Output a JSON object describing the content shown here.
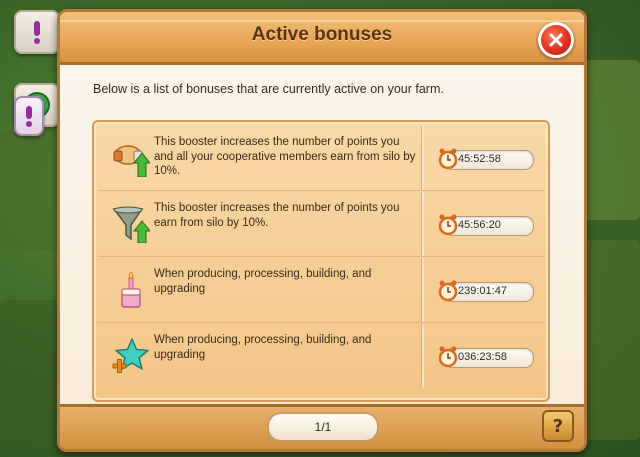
{
  "window": {
    "title": "Active bonuses",
    "description": "Below is a list of bonuses that are currently active on your farm.",
    "close_icon": "close-icon"
  },
  "bonuses": [
    {
      "icon": "handshake-booster-icon",
      "text": "This booster increases the number of points you and all your cooperative members earn from silo by 10%.",
      "time": "45:52:58"
    },
    {
      "icon": "funnel-booster-icon",
      "text": "This booster increases the number of points you earn from silo by 10%.",
      "time": "45:56:20"
    },
    {
      "icon": "birthday-cake-icon",
      "text": "When producing, processing, building, and upgrading",
      "time": "239:01:47"
    },
    {
      "icon": "star-plus-icon",
      "text": "When producing, processing, building, and upgrading",
      "time": "036:23:58"
    }
  ],
  "footer": {
    "pagination": "1/1",
    "help_label": "?"
  },
  "colors": {
    "header": "#e8a75a",
    "panel": "#f2c585",
    "close": "#e0301c"
  }
}
